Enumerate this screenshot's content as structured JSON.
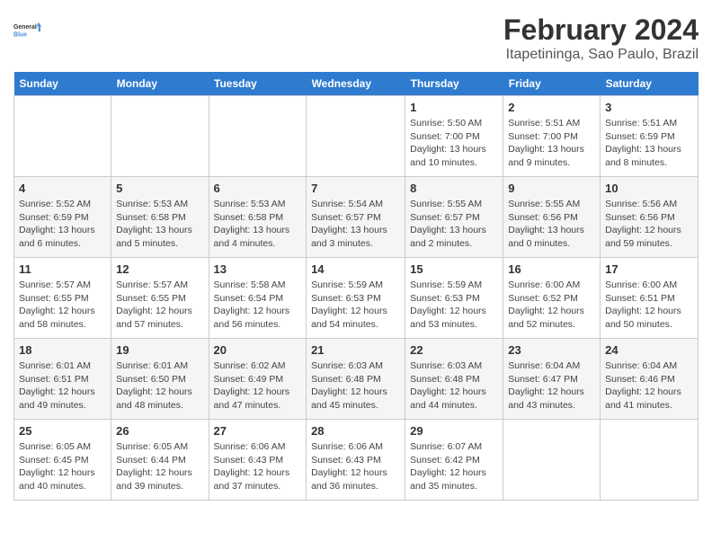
{
  "logo": {
    "line1": "General",
    "line2": "Blue"
  },
  "title": "February 2024",
  "subtitle": "Itapetininga, Sao Paulo, Brazil",
  "days_of_week": [
    "Sunday",
    "Monday",
    "Tuesday",
    "Wednesday",
    "Thursday",
    "Friday",
    "Saturday"
  ],
  "weeks": [
    [
      {
        "day": "",
        "info": ""
      },
      {
        "day": "",
        "info": ""
      },
      {
        "day": "",
        "info": ""
      },
      {
        "day": "",
        "info": ""
      },
      {
        "day": "1",
        "info": "Sunrise: 5:50 AM\nSunset: 7:00 PM\nDaylight: 13 hours\nand 10 minutes."
      },
      {
        "day": "2",
        "info": "Sunrise: 5:51 AM\nSunset: 7:00 PM\nDaylight: 13 hours\nand 9 minutes."
      },
      {
        "day": "3",
        "info": "Sunrise: 5:51 AM\nSunset: 6:59 PM\nDaylight: 13 hours\nand 8 minutes."
      }
    ],
    [
      {
        "day": "4",
        "info": "Sunrise: 5:52 AM\nSunset: 6:59 PM\nDaylight: 13 hours\nand 6 minutes."
      },
      {
        "day": "5",
        "info": "Sunrise: 5:53 AM\nSunset: 6:58 PM\nDaylight: 13 hours\nand 5 minutes."
      },
      {
        "day": "6",
        "info": "Sunrise: 5:53 AM\nSunset: 6:58 PM\nDaylight: 13 hours\nand 4 minutes."
      },
      {
        "day": "7",
        "info": "Sunrise: 5:54 AM\nSunset: 6:57 PM\nDaylight: 13 hours\nand 3 minutes."
      },
      {
        "day": "8",
        "info": "Sunrise: 5:55 AM\nSunset: 6:57 PM\nDaylight: 13 hours\nand 2 minutes."
      },
      {
        "day": "9",
        "info": "Sunrise: 5:55 AM\nSunset: 6:56 PM\nDaylight: 13 hours\nand 0 minutes."
      },
      {
        "day": "10",
        "info": "Sunrise: 5:56 AM\nSunset: 6:56 PM\nDaylight: 12 hours\nand 59 minutes."
      }
    ],
    [
      {
        "day": "11",
        "info": "Sunrise: 5:57 AM\nSunset: 6:55 PM\nDaylight: 12 hours\nand 58 minutes."
      },
      {
        "day": "12",
        "info": "Sunrise: 5:57 AM\nSunset: 6:55 PM\nDaylight: 12 hours\nand 57 minutes."
      },
      {
        "day": "13",
        "info": "Sunrise: 5:58 AM\nSunset: 6:54 PM\nDaylight: 12 hours\nand 56 minutes."
      },
      {
        "day": "14",
        "info": "Sunrise: 5:59 AM\nSunset: 6:53 PM\nDaylight: 12 hours\nand 54 minutes."
      },
      {
        "day": "15",
        "info": "Sunrise: 5:59 AM\nSunset: 6:53 PM\nDaylight: 12 hours\nand 53 minutes."
      },
      {
        "day": "16",
        "info": "Sunrise: 6:00 AM\nSunset: 6:52 PM\nDaylight: 12 hours\nand 52 minutes."
      },
      {
        "day": "17",
        "info": "Sunrise: 6:00 AM\nSunset: 6:51 PM\nDaylight: 12 hours\nand 50 minutes."
      }
    ],
    [
      {
        "day": "18",
        "info": "Sunrise: 6:01 AM\nSunset: 6:51 PM\nDaylight: 12 hours\nand 49 minutes."
      },
      {
        "day": "19",
        "info": "Sunrise: 6:01 AM\nSunset: 6:50 PM\nDaylight: 12 hours\nand 48 minutes."
      },
      {
        "day": "20",
        "info": "Sunrise: 6:02 AM\nSunset: 6:49 PM\nDaylight: 12 hours\nand 47 minutes."
      },
      {
        "day": "21",
        "info": "Sunrise: 6:03 AM\nSunset: 6:48 PM\nDaylight: 12 hours\nand 45 minutes."
      },
      {
        "day": "22",
        "info": "Sunrise: 6:03 AM\nSunset: 6:48 PM\nDaylight: 12 hours\nand 44 minutes."
      },
      {
        "day": "23",
        "info": "Sunrise: 6:04 AM\nSunset: 6:47 PM\nDaylight: 12 hours\nand 43 minutes."
      },
      {
        "day": "24",
        "info": "Sunrise: 6:04 AM\nSunset: 6:46 PM\nDaylight: 12 hours\nand 41 minutes."
      }
    ],
    [
      {
        "day": "25",
        "info": "Sunrise: 6:05 AM\nSunset: 6:45 PM\nDaylight: 12 hours\nand 40 minutes."
      },
      {
        "day": "26",
        "info": "Sunrise: 6:05 AM\nSunset: 6:44 PM\nDaylight: 12 hours\nand 39 minutes."
      },
      {
        "day": "27",
        "info": "Sunrise: 6:06 AM\nSunset: 6:43 PM\nDaylight: 12 hours\nand 37 minutes."
      },
      {
        "day": "28",
        "info": "Sunrise: 6:06 AM\nSunset: 6:43 PM\nDaylight: 12 hours\nand 36 minutes."
      },
      {
        "day": "29",
        "info": "Sunrise: 6:07 AM\nSunset: 6:42 PM\nDaylight: 12 hours\nand 35 minutes."
      },
      {
        "day": "",
        "info": ""
      },
      {
        "day": "",
        "info": ""
      }
    ]
  ]
}
